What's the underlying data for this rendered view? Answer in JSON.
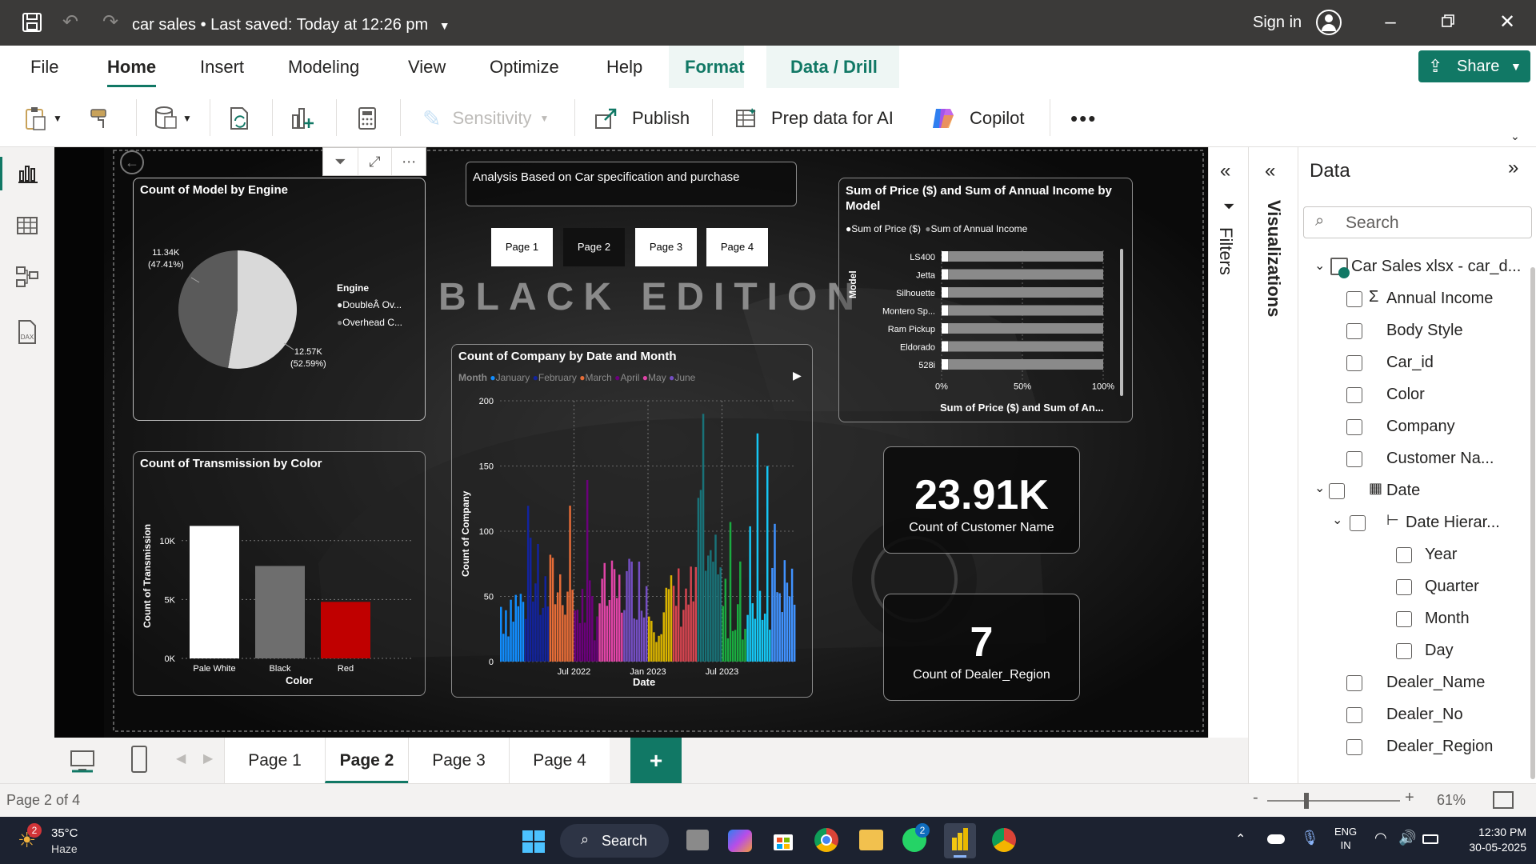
{
  "window": {
    "doc_title": "car sales",
    "saved_status": "Last saved: Today at 12:26 pm",
    "sign_in": "Sign in"
  },
  "menu": [
    "File",
    "Home",
    "Insert",
    "Modeling",
    "View",
    "Optimize",
    "Help",
    "Format",
    "Data / Drill"
  ],
  "share_label": "Share",
  "ribbon": {
    "sensitivity": "Sensitivity",
    "publish": "Publish",
    "prep_data": "Prep data for AI",
    "copilot": "Copilot"
  },
  "report": {
    "header_text": "Analysis Based on Car specification and purchase",
    "banner": "BLACK EDITION",
    "page_buttons": [
      "Page 1",
      "Page 2",
      "Page 3",
      "Page 4"
    ],
    "card_customers": {
      "value": "23.91K",
      "label": "Count of Customer Name"
    },
    "card_regions": {
      "value": "7",
      "label": "Count of Dealer_Region"
    }
  },
  "chart_data": [
    {
      "type": "pie",
      "title": "Count of Model by Engine",
      "legend_title": "Engine",
      "legend": [
        "DoubleÂ Ov...",
        "Overhead C..."
      ],
      "values": [
        11340,
        12570
      ],
      "labels": [
        "11.34K",
        "12.57K"
      ],
      "percent_labels": [
        "(47.41%)",
        "(52.59%)"
      ],
      "colors": [
        "#5a5a5a",
        "#d9d9d9"
      ]
    },
    {
      "type": "bar",
      "title": "Count of Transmission by Color",
      "xlabel": "Color",
      "ylabel": "Count of Transmission",
      "categories": [
        "Pale White",
        "Black",
        "Red"
      ],
      "values": [
        11250,
        7850,
        4800
      ],
      "colors": [
        "#ffffff",
        "#6e6e6e",
        "#c00000"
      ],
      "yticks": [
        "0K",
        "5K",
        "10K"
      ],
      "ylim": [
        0,
        12500
      ]
    },
    {
      "type": "bar",
      "title": "Count of Company by Date and Month",
      "xlabel": "Date",
      "ylabel": "Count of Company",
      "legend_title": "Month",
      "legend": [
        "January",
        "February",
        "March",
        "April",
        "May",
        "June"
      ],
      "legend_colors": [
        "#118dff",
        "#12239e",
        "#e66c37",
        "#6b007b",
        "#e044a7",
        "#744ec2"
      ],
      "xticks": [
        "Jul 2022",
        "Jan 2023",
        "Jul 2023"
      ],
      "yticks": [
        "0",
        "50",
        "100",
        "150",
        "200"
      ],
      "ylim": [
        0,
        200
      ]
    },
    {
      "type": "bar",
      "orientation": "horizontal",
      "stacked_percent": true,
      "title": "Sum of Price ($) and Sum of Annual Income by Model",
      "xlabel": "Sum of Price ($) and Sum of An...",
      "ylabel": "Model",
      "legend": [
        "Sum of Price ($)",
        "Sum of Annual Income"
      ],
      "categories": [
        "LS400",
        "Jetta",
        "Silhouette",
        "Montero Sp...",
        "Ram Pickup",
        "Eldorado",
        "528i"
      ],
      "series": [
        {
          "name": "Sum of Price ($)",
          "values": [
            4,
            4,
            4,
            4,
            4,
            4,
            4
          ]
        },
        {
          "name": "Sum of Annual Income",
          "values": [
            96,
            96,
            96,
            96,
            96,
            96,
            96
          ]
        }
      ],
      "xticks": [
        "0%",
        "50%",
        "100%"
      ]
    }
  ],
  "panes": {
    "filters": "Filters",
    "visualizations": "Visualizations",
    "data_title": "Data",
    "search_placeholder": "Search",
    "table_name": "Car Sales xlsx - car_d...",
    "fields": [
      "Annual Income",
      "Body Style",
      "Car_id",
      "Color",
      "Company",
      "Customer Na...",
      "Date",
      "Date Hierar...",
      "Year",
      "Quarter",
      "Month",
      "Day",
      "Dealer_Name",
      "Dealer_No",
      "Dealer_Region"
    ]
  },
  "page_tabs": [
    "Page 1",
    "Page 2",
    "Page 3",
    "Page 4"
  ],
  "status": {
    "page_info": "Page 2 of 4",
    "zoom": "61%"
  },
  "taskbar": {
    "weather_temp": "35°C",
    "weather_desc": "Haze",
    "weather_badge": "2",
    "search": "Search",
    "whatsapp_badge": "2",
    "lang1": "ENG",
    "lang2": "IN",
    "time": "12:30 PM",
    "date": "30-05-2025"
  }
}
